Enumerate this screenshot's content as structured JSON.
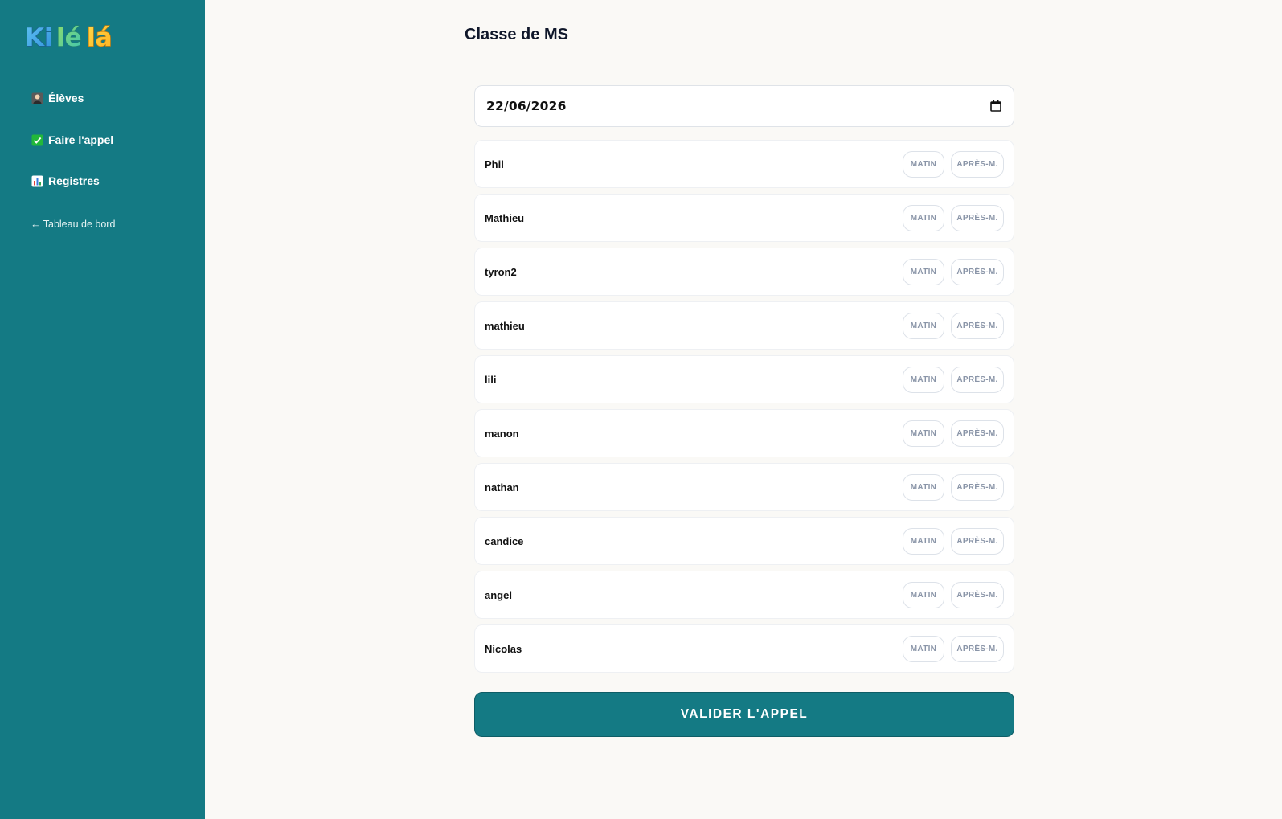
{
  "brand": {
    "logo_text": "Kilélá"
  },
  "sidebar": {
    "items": [
      {
        "icon": "student-icon",
        "label": "Élèves"
      },
      {
        "icon": "check-box-icon",
        "label": "Faire l'appel"
      },
      {
        "icon": "bar-chart-icon",
        "label": "Registres"
      }
    ],
    "back_label": "← Tableau de bord"
  },
  "main": {
    "title": "Classe de MS",
    "date_value": "22/06/2026",
    "morning_label": "MATIN",
    "afternoon_label": "APRÈS-M.",
    "students": [
      {
        "name": "Phil"
      },
      {
        "name": "Mathieu"
      },
      {
        "name": "tyron2"
      },
      {
        "name": "mathieu"
      },
      {
        "name": "lili"
      },
      {
        "name": "manon"
      },
      {
        "name": "nathan"
      },
      {
        "name": "candice"
      },
      {
        "name": "angel"
      },
      {
        "name": "Nicolas"
      }
    ],
    "submit_label": "VALIDER L'APPEL"
  },
  "colors": {
    "sidebar_bg": "#147a84",
    "page_bg": "#faf9f6",
    "accent": "#147a84",
    "pill_text": "#8a95a8"
  }
}
